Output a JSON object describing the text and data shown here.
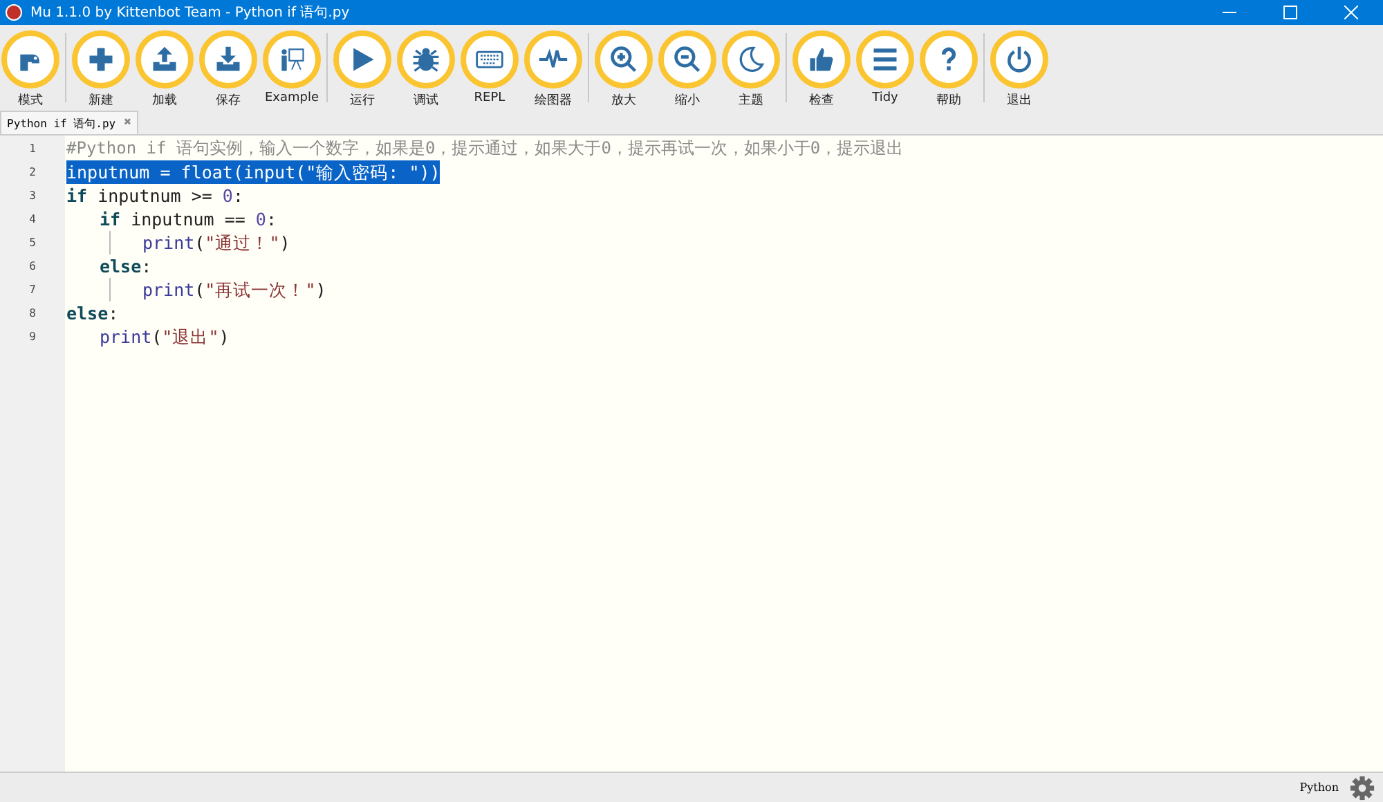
{
  "window": {
    "title": "Mu 1.1.0 by Kittenbot Team - Python if 语句.py"
  },
  "toolbar": {
    "groups": [
      [
        {
          "label": "模式"
        }
      ],
      [
        {
          "label": "新建"
        },
        {
          "label": "加载"
        },
        {
          "label": "保存"
        },
        {
          "label": "Example"
        }
      ],
      [
        {
          "label": "运行"
        },
        {
          "label": "调试"
        },
        {
          "label": "REPL"
        },
        {
          "label": "绘图器"
        }
      ],
      [
        {
          "label": "放大"
        },
        {
          "label": "缩小"
        },
        {
          "label": "主题"
        }
      ],
      [
        {
          "label": "检查"
        },
        {
          "label": "Tidy"
        },
        {
          "label": "帮助"
        }
      ],
      [
        {
          "label": "退出"
        }
      ]
    ]
  },
  "tabs": [
    {
      "label": "Python if 语句.py",
      "close": "✖",
      "selected": true
    }
  ],
  "editor": {
    "lines": [
      {
        "number": "1",
        "selected": false,
        "tokens": [
          {
            "kind": "comment",
            "text": "#Python if 语句实例，输入一个数字，如果是0，提示通过，如果大于0，提示再试一次，如果小于0，提示退出"
          }
        ]
      },
      {
        "number": "2",
        "selected": true,
        "tokens": [
          {
            "kind": "name",
            "text": "inputnum = "
          },
          {
            "kind": "builtin",
            "text": "float"
          },
          {
            "kind": "punct",
            "text": "("
          },
          {
            "kind": "builtin",
            "text": "input"
          },
          {
            "kind": "punct",
            "text": "("
          },
          {
            "kind": "string",
            "text": "\"输入密码: \""
          },
          {
            "kind": "punct",
            "text": "))"
          }
        ]
      },
      {
        "number": "3",
        "selected": false,
        "tokens": [
          {
            "kind": "keyword",
            "text": "if"
          },
          {
            "kind": "name",
            "text": " inputnum >= "
          },
          {
            "kind": "number",
            "text": "0"
          },
          {
            "kind": "punct",
            "text": ":"
          }
        ],
        "children": [
          {
            "number": "4",
            "selected": false,
            "tokens": [
              {
                "kind": "keyword",
                "text": "if"
              },
              {
                "kind": "name",
                "text": " inputnum == "
              },
              {
                "kind": "number",
                "text": "0"
              },
              {
                "kind": "punct",
                "text": ":"
              }
            ],
            "children": [
              {
                "number": "5",
                "selected": false,
                "tokens": [
                  {
                    "kind": "builtin",
                    "text": "print"
                  },
                  {
                    "kind": "punct",
                    "text": "("
                  },
                  {
                    "kind": "string",
                    "text": "\"通过！\""
                  },
                  {
                    "kind": "punct",
                    "text": ")"
                  }
                ]
              }
            ]
          },
          {
            "number": "6",
            "selected": false,
            "tokens": [
              {
                "kind": "keyword",
                "text": "else"
              },
              {
                "kind": "punct",
                "text": ":"
              }
            ],
            "children": [
              {
                "number": "7",
                "selected": false,
                "tokens": [
                  {
                    "kind": "builtin",
                    "text": "print"
                  },
                  {
                    "kind": "punct",
                    "text": "("
                  },
                  {
                    "kind": "string",
                    "text": "\"再试一次！\""
                  },
                  {
                    "kind": "punct",
                    "text": ")"
                  }
                ]
              }
            ]
          }
        ]
      },
      {
        "number": "8",
        "selected": false,
        "tokens": [
          {
            "kind": "keyword",
            "text": "else"
          },
          {
            "kind": "punct",
            "text": ":"
          }
        ],
        "children": [
          {
            "number": "9",
            "selected": false,
            "tokens": [
              {
                "kind": "builtin",
                "text": "print"
              },
              {
                "kind": "punct",
                "text": "("
              },
              {
                "kind": "string",
                "text": "\"退出\""
              },
              {
                "kind": "punct",
                "text": ")"
              }
            ]
          }
        ]
      }
    ]
  },
  "status_bar": {
    "mode": "Python"
  }
}
